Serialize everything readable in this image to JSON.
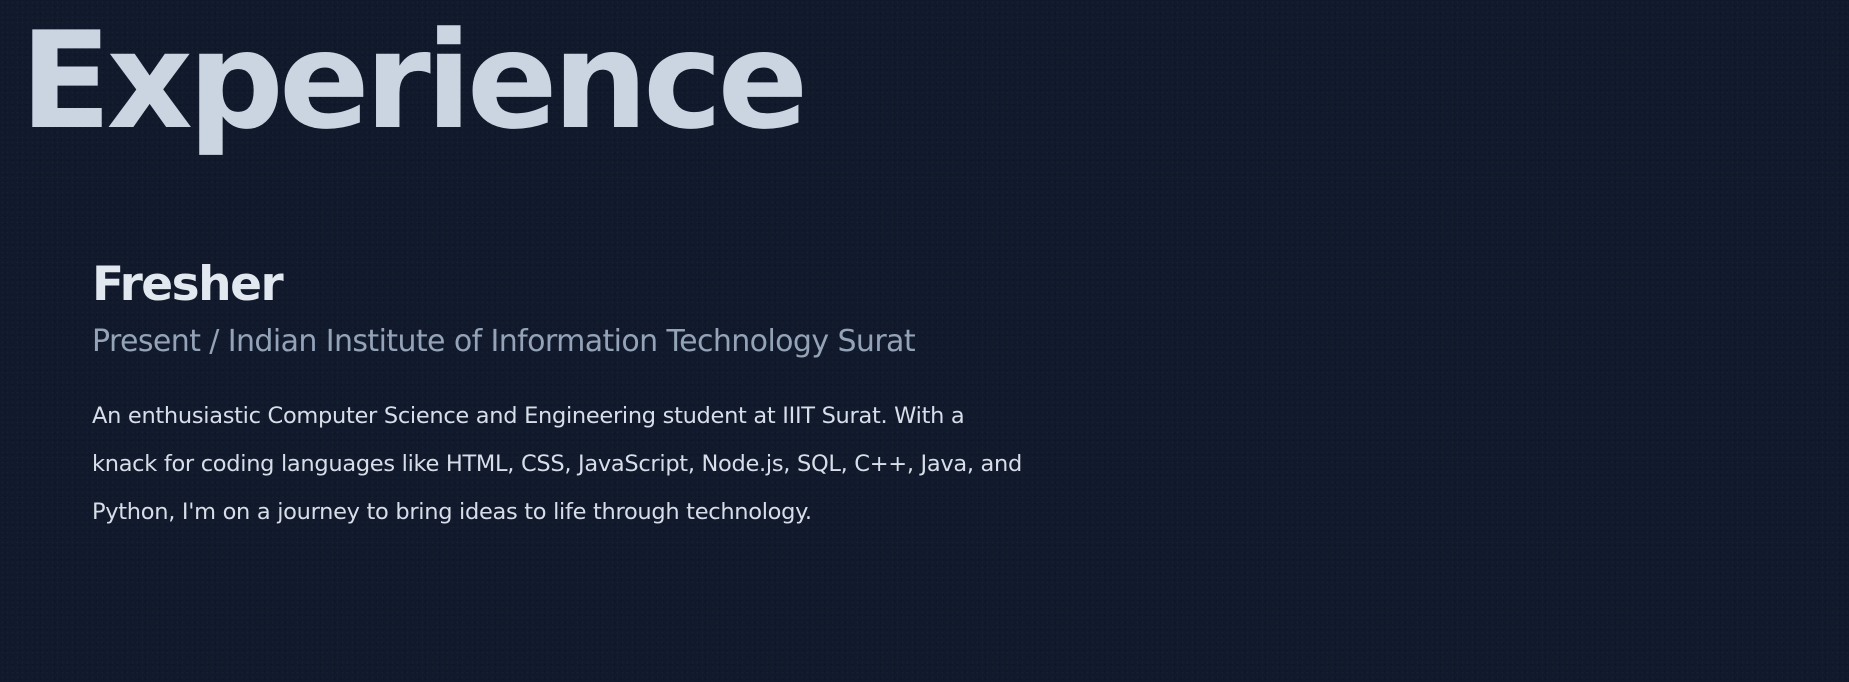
{
  "section": {
    "title": "Experience"
  },
  "experience": [
    {
      "role": "Fresher",
      "meta": "Present / Indian Institute of Information Technology Surat",
      "description": "An enthusiastic Computer Science and Engineering student at IIIT Surat. With a knack for coding languages like HTML, CSS, JavaScript, Node.js, SQL, C++, Java, and Python, I'm on a journey to bring ideas to life through technology."
    }
  ],
  "colors": {
    "background": "#111a2c",
    "heading": "#cbd5e1",
    "role": "#e2e8f0",
    "meta": "#94a3b8",
    "body_text": "#d8dee9"
  }
}
